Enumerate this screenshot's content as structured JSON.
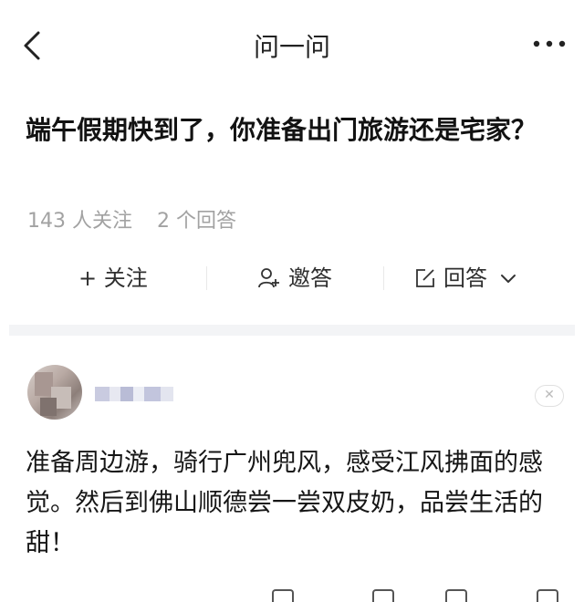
{
  "header": {
    "title": "问一问"
  },
  "question": {
    "text": "端午假期快到了，你准备出门旅游还是宅家？",
    "followers": "143 人关注",
    "answers_count": "2 个回答"
  },
  "actions": {
    "follow": "+ 关注",
    "invite": "邀答",
    "answer": "回答"
  },
  "answer": {
    "text": "准备周边游，骑行广州兜风，感受江风拂面的感觉。然后到佛山顺德尝一尝双皮奶，品尝生活的甜！"
  },
  "icons": {
    "back": "chevron-left-icon",
    "more": "more-dots-icon",
    "invite": "invite-user-icon",
    "edit": "edit-icon",
    "dropdown": "chevron-down-icon",
    "close": "close-icon"
  },
  "colors": {
    "meta_gray": "#a2a2a2",
    "divider_bg": "#f3f4f6",
    "text_dark": "#1a1a1a"
  }
}
